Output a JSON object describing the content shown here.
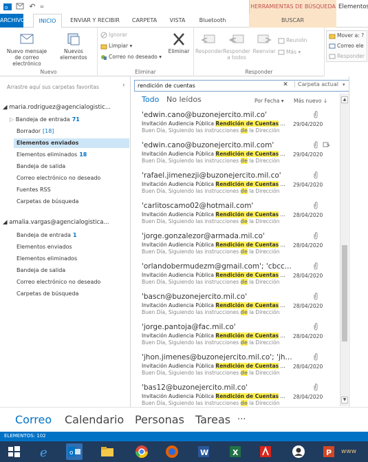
{
  "titlebar": {
    "tools_context": "HERRAMIENTAS DE BÚSQUEDA",
    "title": "Elementos"
  },
  "tabs": [
    {
      "label": "ARCHIVO"
    },
    {
      "label": "INICIO"
    },
    {
      "label": "ENVIAR Y RECIBIR"
    },
    {
      "label": "CARPETA"
    },
    {
      "label": "VISTA"
    },
    {
      "label": "Bluetooth"
    },
    {
      "label": "BUSCAR"
    }
  ],
  "ribbon": {
    "nuevo": {
      "label": "Nuevo",
      "new_mail": "Nuevo mensaje de correo electrónico",
      "new_items": "Nuevos elementos"
    },
    "eliminar": {
      "label": "Eliminar",
      "ignore": "Ignorar",
      "clean": "Limpiar",
      "junk": "Correo no deseado",
      "delete": "Eliminar"
    },
    "responder": {
      "label": "Responder",
      "reply": "Responder",
      "reply_all": "Responder a todos",
      "forward": "Reenviar",
      "meeting": "Reunión",
      "more": "Más"
    },
    "pasos": {
      "move_to": "Mover a: ?",
      "mail_to": "Correo ele",
      "reply_del": "Responder"
    }
  },
  "leftpane": {
    "fav_hint": "Arrastre aquí sus carpetas favoritas",
    "accounts": [
      {
        "name": "maria.rodriguez@agencialogistic...",
        "folders": [
          {
            "label": "Bandeja de entrada",
            "count": "71"
          },
          {
            "label": "Borrador",
            "count": "[18]"
          },
          {
            "label": "Elementos enviados",
            "count": ""
          },
          {
            "label": "Elementos eliminados",
            "count": "18"
          },
          {
            "label": "Bandeja de salida",
            "count": ""
          },
          {
            "label": "Correo electrónico no deseado",
            "count": ""
          },
          {
            "label": "Fuentes RSS",
            "count": ""
          },
          {
            "label": "Carpetas de búsqueda",
            "count": ""
          }
        ]
      },
      {
        "name": "amalia.vargas@agencialogistica...",
        "folders": [
          {
            "label": "Bandeja de entrada",
            "count": "1"
          },
          {
            "label": "Elementos enviados",
            "count": ""
          },
          {
            "label": "Elementos eliminados",
            "count": ""
          },
          {
            "label": "Bandeja de salida",
            "count": ""
          },
          {
            "label": "Correo electrónico no deseado",
            "count": ""
          },
          {
            "label": "Carpetas de búsqueda",
            "count": ""
          }
        ]
      }
    ]
  },
  "search": {
    "value": "rendición de cuentas",
    "clear": "✕",
    "scope": "Carpeta actual"
  },
  "filters": {
    "all": "Todo",
    "unread": "No leídos",
    "sort_by": "Por Fecha",
    "order": "Más nuevo"
  },
  "messages": [
    {
      "from": "'edwin.cano@buzonejercito.mil.co'",
      "date": "29/04/2020",
      "extra": false
    },
    {
      "from": "'edwin.cano@buzonejercito.mil.com'",
      "date": "29/04/2020",
      "extra": true
    },
    {
      "from": "'rafael.jimenezji@buzonejercito.mil.co'",
      "date": "29/04/2020",
      "extra": false
    },
    {
      "from": "'carlitoscamo02@hotmail.com'",
      "date": "28/04/2020",
      "extra": false
    },
    {
      "from": "'jorge.gonzalezor@armada.mil.co'",
      "date": "28/04/2020",
      "extra": false
    },
    {
      "from": "'orlandobermudezm@gmail.com'; 'cbcc...",
      "date": "28/04/2020",
      "extra": false
    },
    {
      "from": "'bascn@buzonejercito.mil.co'",
      "date": "28/04/2020",
      "extra": false
    },
    {
      "from": "'jorge.pantoja@fac.mil.co'",
      "date": "28/04/2020",
      "extra": false
    },
    {
      "from": "'jhon.jimenes@buzonejercito.mil.co'; 'jh...",
      "date": "28/04/2020",
      "extra": false
    },
    {
      "from": "'bas12@buzonejercito.mil.co'",
      "date": "28/04/2020",
      "extra": false
    }
  ],
  "message_subject": {
    "pre": "Invitación Audiencia Pública ",
    "hl": "Rendición de Cuentas",
    "post": " ..."
  },
  "message_preview": {
    "pre": "Buen Día,  Siguiendo las instrucciones ",
    "hl": "de",
    "post": " la Dirección"
  },
  "navbar": {
    "mail": "Correo",
    "calendar": "Calendario",
    "people": "Personas",
    "tasks": "Tareas",
    "more": "···"
  },
  "status": {
    "text": "ELEMENTOS: 102"
  },
  "taskbar": {
    "overflow_text": "www"
  },
  "colors": {
    "accent": "#0072c6",
    "search_tools": "#fbe3c7",
    "highlight": "#fff04d",
    "taskbar": "#1f3b5e"
  }
}
